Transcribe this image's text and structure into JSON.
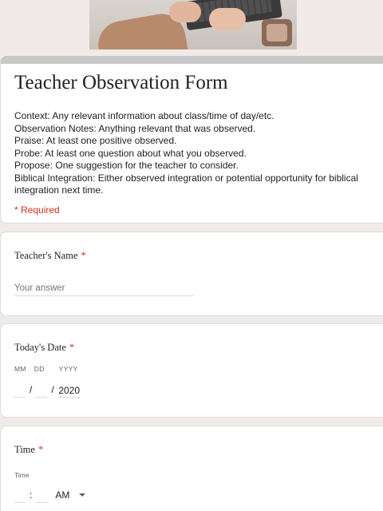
{
  "form": {
    "title": "Teacher Observation Form",
    "description": "Context: Any relevant information about class/time of day/etc.\nObservation Notes: Anything relevant that was observed.\nPraise: At least one positive observed.\nProbe: At least one question about what you observed.\nPropose: One suggestion for the teacher to consider.\nBiblical Integration: Either observed integration or potential opportunity for biblical integration next time.",
    "required_note": "* Required"
  },
  "questions": {
    "teacher_name": {
      "label": "Teacher's Name",
      "required_mark": "*",
      "placeholder": "Your answer"
    },
    "todays_date": {
      "label": "Today's Date",
      "required_mark": "*",
      "mm_label": "MM",
      "dd_label": "DD",
      "yyyy_label": "YYYY",
      "separator": "/",
      "month_value": "",
      "day_value": "",
      "year_value": "2020"
    },
    "time": {
      "label": "Time",
      "required_mark": "*",
      "sublabel": "Time",
      "separator": ":",
      "hour_value": "",
      "minute_value": "",
      "ampm_value": "AM"
    }
  },
  "colors": {
    "required": "#d93025",
    "background": "#f0ebe8",
    "header_bar": "#c9c9c9"
  }
}
